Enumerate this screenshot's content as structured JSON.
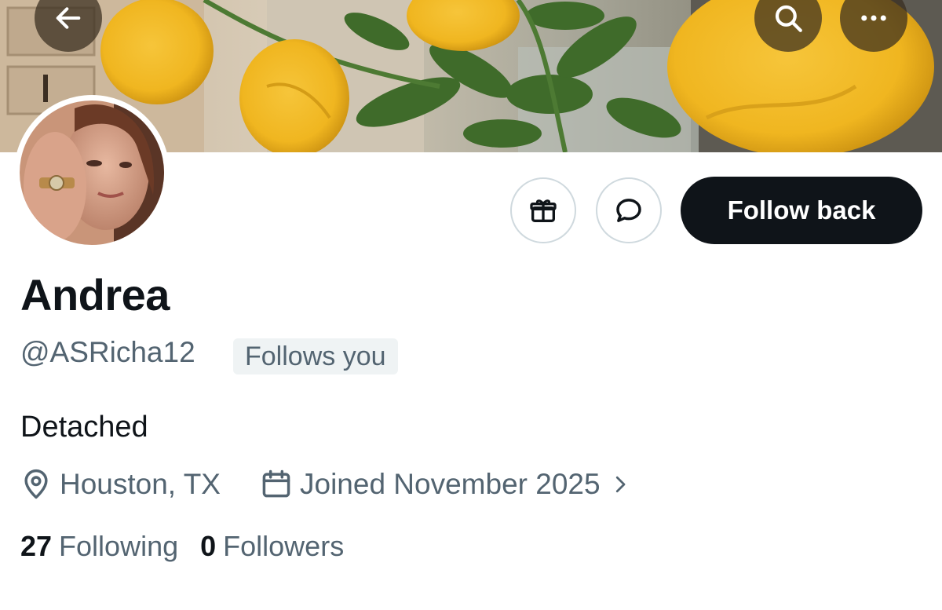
{
  "header": {
    "back_icon": "arrow-left-icon",
    "search_icon": "search-icon",
    "more_icon": "more-horizontal-icon"
  },
  "profile": {
    "display_name": "Andrea",
    "handle": "@ASRicha12",
    "follows_you_badge": "Follows you",
    "bio": "Detached",
    "location": "Houston, TX",
    "joined": "Joined November 2025",
    "following_count": "27",
    "following_label": "Following",
    "followers_count": "0",
    "followers_label": "Followers"
  },
  "actions": {
    "gift_icon": "gift-icon",
    "message_icon": "message-bubble-icon",
    "follow_label": "Follow back"
  },
  "colors": {
    "primary_text": "#0f1419",
    "secondary_text": "#536471",
    "button_dark": "#0f1419",
    "badge_bg": "#eff3f4",
    "border": "#cfd9de"
  }
}
